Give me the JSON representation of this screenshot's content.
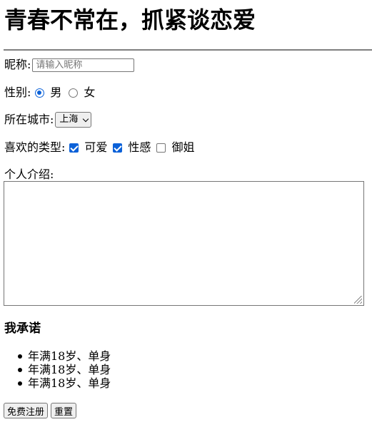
{
  "title": "青春不常在，抓紧谈恋爱",
  "nickname": {
    "label": "昵称:",
    "placeholder": "请输入昵称",
    "value": ""
  },
  "gender": {
    "label": "性别:",
    "options": [
      {
        "label": "男",
        "checked": true
      },
      {
        "label": "女",
        "checked": false
      }
    ]
  },
  "city": {
    "label": "所在城市:",
    "selected": "上海"
  },
  "preference": {
    "label": "喜欢的类型:",
    "options": [
      {
        "label": "可爱",
        "checked": true
      },
      {
        "label": "性感",
        "checked": true
      },
      {
        "label": "御姐",
        "checked": false
      }
    ]
  },
  "intro": {
    "label": "个人介绍:",
    "value": ""
  },
  "promise": {
    "heading": "我承诺",
    "items": [
      "年满18岁、单身",
      "年满18岁、单身",
      "年满18岁、单身"
    ]
  },
  "buttons": {
    "submit": "免费注册",
    "reset": "重置"
  },
  "colors": {
    "accent": "#0b61d8",
    "divider": "#7f7f7f"
  }
}
